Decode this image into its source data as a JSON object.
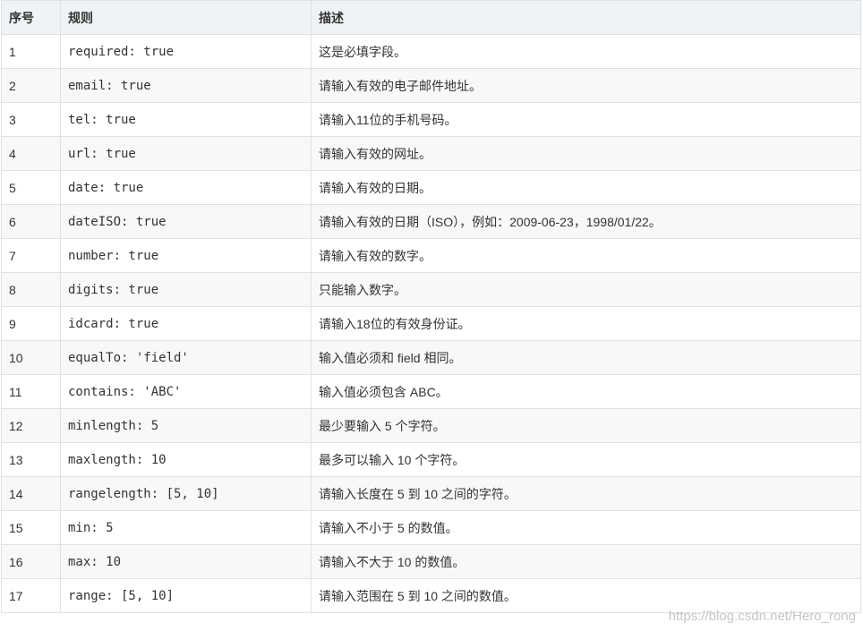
{
  "table": {
    "headers": [
      "序号",
      "规则",
      "描述"
    ],
    "rows": [
      {
        "num": "1",
        "rule": "required: true",
        "desc": "这是必填字段。"
      },
      {
        "num": "2",
        "rule": "email: true",
        "desc": "请输入有效的电子邮件地址。"
      },
      {
        "num": "3",
        "rule": "tel: true",
        "desc": "请输入11位的手机号码。"
      },
      {
        "num": "4",
        "rule": "url: true",
        "desc": "请输入有效的网址。"
      },
      {
        "num": "5",
        "rule": "date: true",
        "desc": "请输入有效的日期。"
      },
      {
        "num": "6",
        "rule": "dateISO: true",
        "desc": "请输入有效的日期（ISO），例如：2009-06-23，1998/01/22。"
      },
      {
        "num": "7",
        "rule": "number: true",
        "desc": "请输入有效的数字。"
      },
      {
        "num": "8",
        "rule": "digits: true",
        "desc": "只能输入数字。"
      },
      {
        "num": "9",
        "rule": "idcard: true",
        "desc": "请输入18位的有效身份证。"
      },
      {
        "num": "10",
        "rule": "equalTo: 'field'",
        "desc": "输入值必须和 field 相同。"
      },
      {
        "num": "11",
        "rule": "contains: 'ABC'",
        "desc": "输入值必须包含 ABC。"
      },
      {
        "num": "12",
        "rule": "minlength: 5",
        "desc": "最少要输入 5 个字符。"
      },
      {
        "num": "13",
        "rule": "maxlength: 10",
        "desc": "最多可以输入 10 个字符。"
      },
      {
        "num": "14",
        "rule": "rangelength: [5, 10]",
        "desc": "请输入长度在 5 到 10 之间的字符。"
      },
      {
        "num": "15",
        "rule": "min: 5",
        "desc": "请输入不小于 5 的数值。"
      },
      {
        "num": "16",
        "rule": "max: 10",
        "desc": "请输入不大于 10 的数值。"
      },
      {
        "num": "17",
        "rule": "range: [5, 10]",
        "desc": "请输入范围在 5 到 10 之间的数值。"
      }
    ]
  },
  "watermark": "https://blog.csdn.net/Hero_rong"
}
